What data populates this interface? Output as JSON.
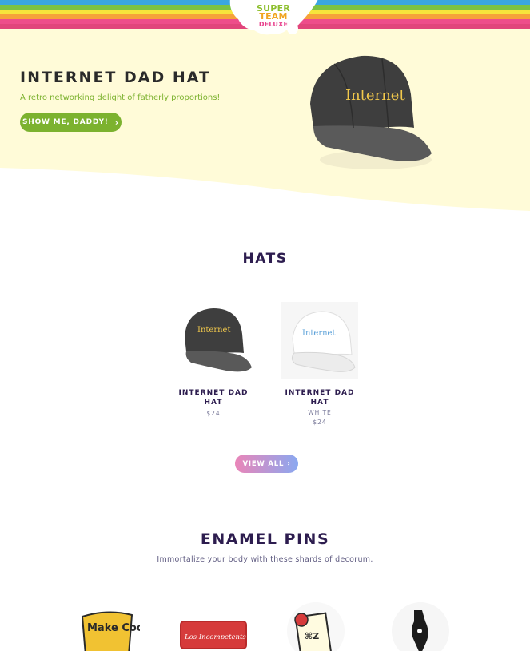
{
  "header": {
    "logo": {
      "line1": "SUPER",
      "line2": "TEAM",
      "line3": "DELUXE"
    },
    "rainbow_colors": [
      "#3aa6e0",
      "#7cc243",
      "#f7e43b",
      "#f6a23a",
      "#ee4d8a",
      "#e1457b"
    ]
  },
  "hero": {
    "title": "INTERNET DAD HAT",
    "subtitle": "A retro networking delight of fatherly proportions!",
    "button_label": "SHOW ME, DADDY!",
    "button_icon": "chevron-right-icon",
    "image_text": "Internet",
    "background": "#fffbd8"
  },
  "hats": {
    "title": "HATS",
    "products": [
      {
        "name": "INTERNET DAD HAT",
        "variant": "",
        "price": "$24",
        "image_text": "Internet",
        "color": "black"
      },
      {
        "name": "INTERNET DAD HAT",
        "variant": "WHITE",
        "price": "$24",
        "image_text": "Internet",
        "color": "white"
      }
    ],
    "view_all_label": "VIEW ALL"
  },
  "pins": {
    "title": "ENAMEL PINS",
    "subtitle": "Immortalize your body with these shards of decorum.",
    "items": [
      {
        "text": "Make Cool Shit"
      },
      {
        "text": "Los Incompetents"
      },
      {
        "text": "⌘Z"
      },
      {
        "text": ""
      }
    ]
  },
  "colors": {
    "accent_green": "#7cb22f",
    "heading_purple": "#2d1d4f"
  }
}
